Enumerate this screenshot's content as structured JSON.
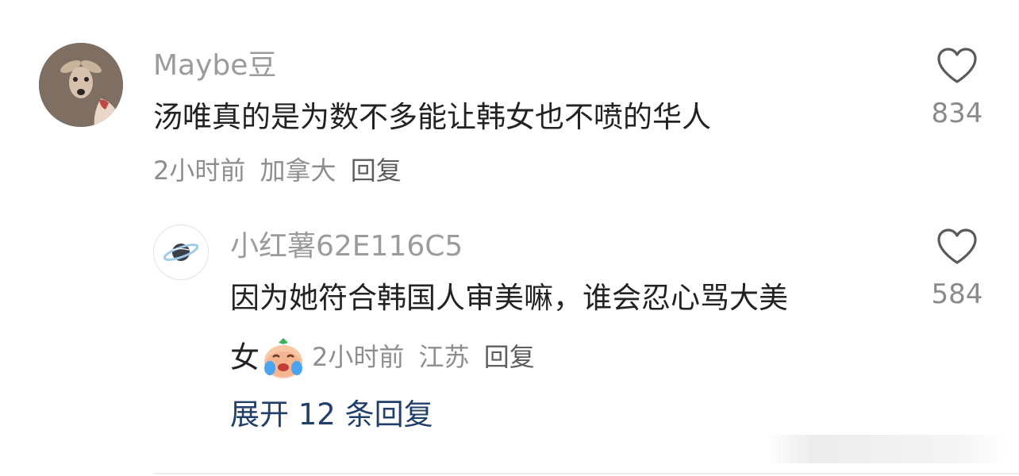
{
  "comment": {
    "username": "Maybe豆",
    "text": "汤唯真的是为数不多能让韩女也不喷的华人",
    "time": "2小时前",
    "location": "加拿大",
    "reply_label": "回复",
    "likes": "834"
  },
  "reply": {
    "username": "小红薯62E116C5",
    "text_line1": "因为她符合韩国人审美嘛，谁会忍心骂大美",
    "text_line2": "女",
    "time": "2小时前",
    "location": "江苏",
    "reply_label": "回复",
    "likes": "584"
  },
  "expand": {
    "label": "展开 12 条回复"
  },
  "icons": {
    "like": "heart-outline-icon",
    "emoji": "laugh-cry-emoji-icon",
    "reply_avatar": "planet-icon"
  },
  "colors": {
    "link": "#213f6b",
    "username": "#9b9b9b",
    "text": "#222222"
  }
}
